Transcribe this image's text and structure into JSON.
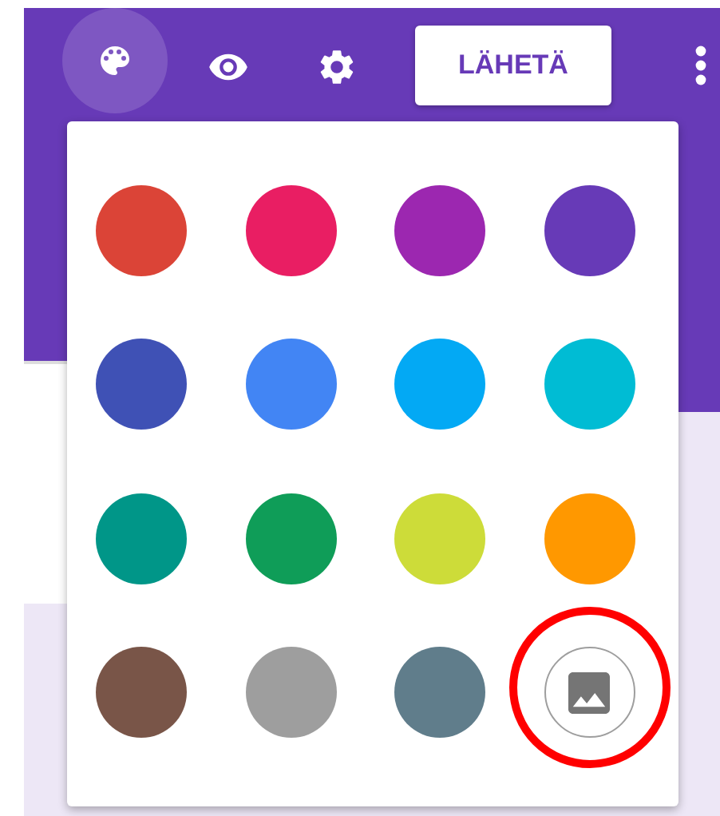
{
  "toolbar": {
    "tools": [
      {
        "kind": "palette",
        "selected": true
      },
      {
        "kind": "preview",
        "selected": false
      },
      {
        "kind": "settings",
        "selected": false
      }
    ],
    "send_button": "LÄHETÄ"
  },
  "color_menu": {
    "swatches": [
      {
        "kind": "color",
        "color": "#db4437",
        "highlighted": false
      },
      {
        "kind": "color",
        "color": "#e91e63",
        "highlighted": false
      },
      {
        "kind": "color",
        "color": "#9c27b0",
        "highlighted": false
      },
      {
        "kind": "color",
        "color": "#673ab7",
        "highlighted": false
      },
      {
        "kind": "color",
        "color": "#3f51b5",
        "highlighted": false
      },
      {
        "kind": "color",
        "color": "#4285f4",
        "highlighted": false
      },
      {
        "kind": "color",
        "color": "#03a9f4",
        "highlighted": false
      },
      {
        "kind": "color",
        "color": "#00bcd4",
        "highlighted": false
      },
      {
        "kind": "color",
        "color": "#009688",
        "highlighted": false
      },
      {
        "kind": "color",
        "color": "#0f9d58",
        "highlighted": false
      },
      {
        "kind": "color",
        "color": "#cddc39",
        "highlighted": false
      },
      {
        "kind": "color",
        "color": "#ff9800",
        "highlighted": false
      },
      {
        "kind": "color",
        "color": "#795548",
        "highlighted": false
      },
      {
        "kind": "color",
        "color": "#9e9e9e",
        "highlighted": false
      },
      {
        "kind": "color",
        "color": "#607d8b",
        "highlighted": false
      },
      {
        "kind": "image",
        "highlighted": true
      }
    ]
  }
}
